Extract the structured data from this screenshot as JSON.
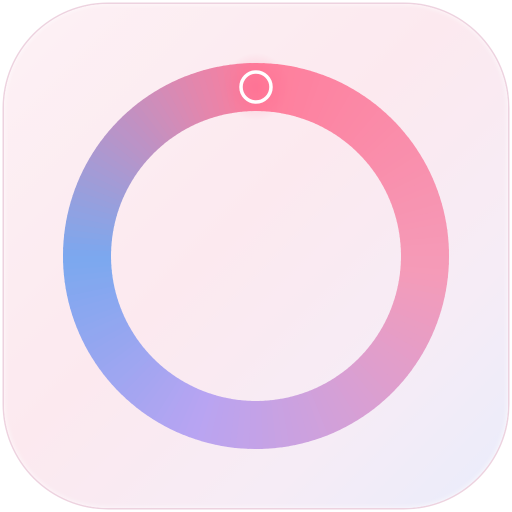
{
  "app_icon": {
    "icon": "ring-timer-icon",
    "colors": {
      "background_top_left": "#fdf1f5",
      "background_bottom_right": "#e9ecfb",
      "ring_top": "#ff7d9b",
      "ring_right": "#f59bb8",
      "ring_bottom": "#b8a4f2",
      "ring_left": "#7ba8ef",
      "knob_stroke": "#ffffff"
    },
    "ring_progress_start_deg": 0,
    "knob_position_deg": 0
  }
}
